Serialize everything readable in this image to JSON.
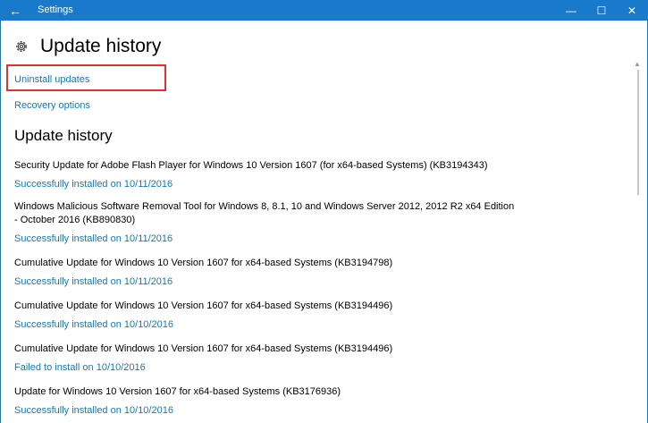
{
  "window": {
    "app_title": "Settings",
    "back_icon": "arrow-left-icon",
    "controls": [
      "minimize-icon",
      "maximize-icon",
      "close-icon"
    ]
  },
  "header": {
    "icon": "gear-icon",
    "title": "Update history"
  },
  "links": {
    "uninstall": "Uninstall updates",
    "recovery": "Recovery options"
  },
  "history": {
    "title": "Update history",
    "items": [
      {
        "name": "Security Update for Adobe Flash Player for Windows 10 Version 1607 (for x64-based Systems) (KB3194343)",
        "status": "Successfully installed on 10/11/2016"
      },
      {
        "name": "Windows Malicious Software Removal Tool for Windows 8, 8.1, 10 and Windows Server 2012, 2012 R2 x64 Edition - October 2016 (KB890830)",
        "status": "Successfully installed on 10/11/2016"
      },
      {
        "name": "Cumulative Update for Windows 10 Version 1607 for x64-based Systems (KB3194798)",
        "status": "Successfully installed on 10/11/2016"
      },
      {
        "name": "Cumulative Update for Windows 10 Version 1607 for x64-based Systems (KB3194496)",
        "status": "Successfully installed on 10/10/2016"
      },
      {
        "name": "Cumulative Update for Windows 10 Version 1607 for x64-based Systems (KB3194496)",
        "status": "Failed to install on 10/10/2016"
      },
      {
        "name": "Update for Windows 10 Version 1607 for x64-based Systems (KB3176936)",
        "status": "Successfully installed on 10/10/2016"
      }
    ]
  },
  "colors": {
    "titlebar": "#1979ca",
    "link": "#1577c2",
    "highlight": "#e03030"
  }
}
